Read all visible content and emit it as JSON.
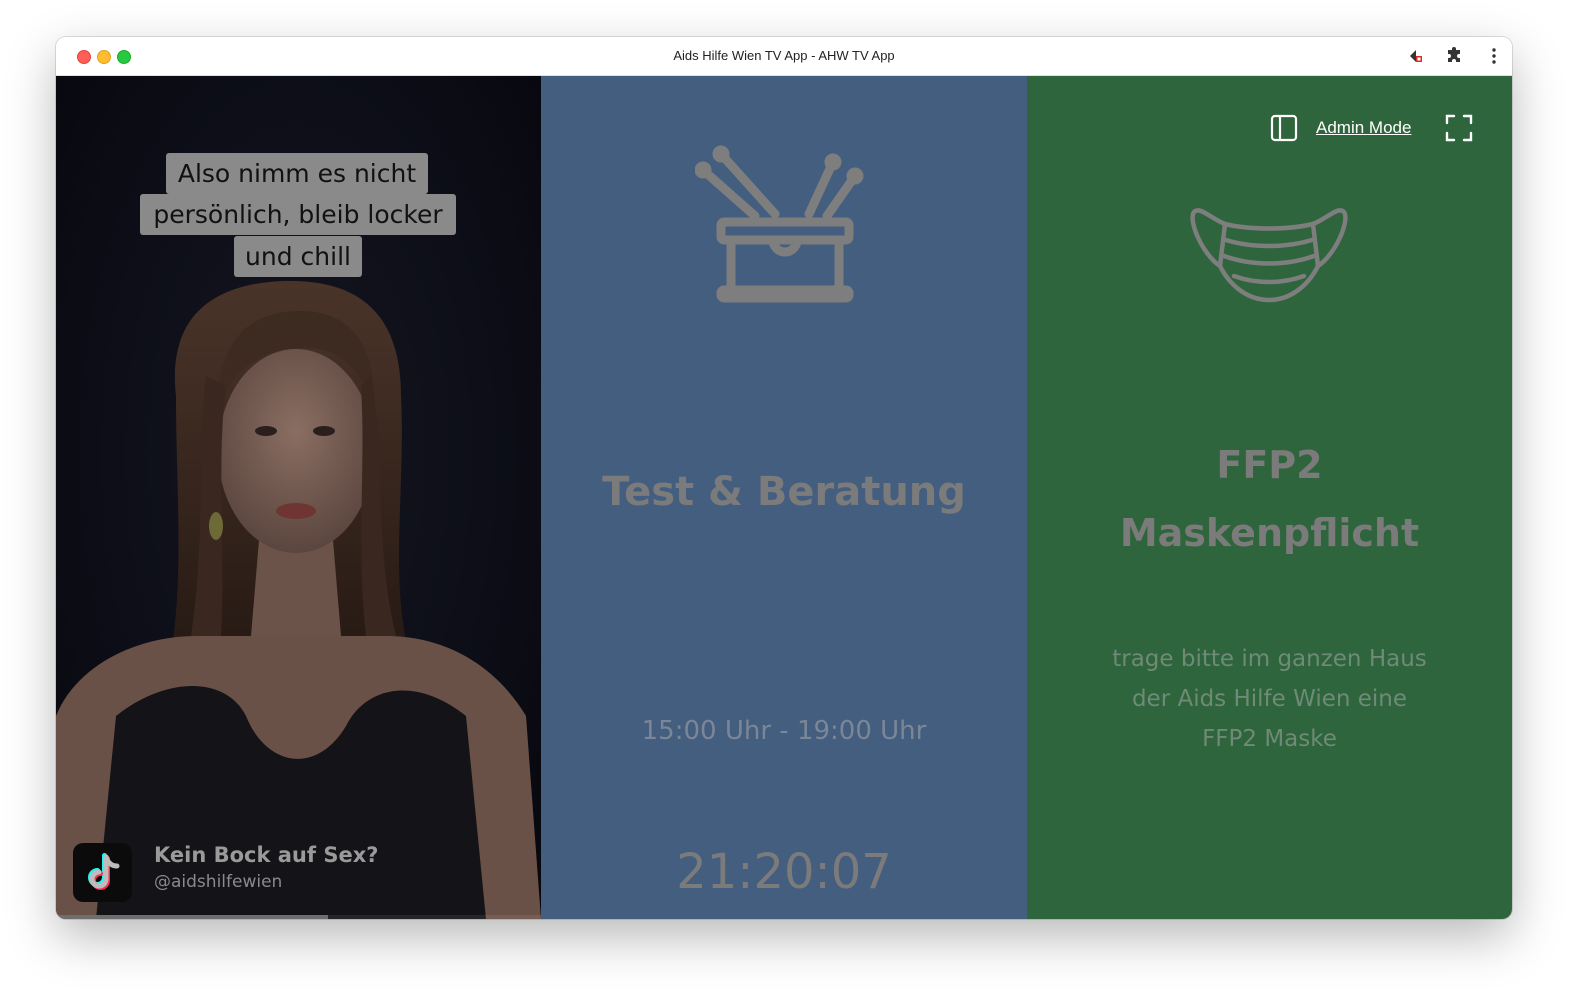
{
  "window": {
    "title": "Aids Hilfe Wien TV App - AHW TV App"
  },
  "video": {
    "caption_lines": [
      "Also nimm es nicht",
      "persönlich, bleib locker",
      "und chill"
    ],
    "tiktok_title": "Kein Bock auf Sex?",
    "tiktok_handle": "@aidshilfewien",
    "progress": 0.56
  },
  "test_panel": {
    "title": "Test & Beratung",
    "hours": "15:00 Uhr - 19:00 Uhr",
    "clock": "21:20:07",
    "icon": "drum-icon"
  },
  "mask_panel": {
    "title_line1": "FFP2",
    "title_line2": "Maskenpflicht",
    "body_line1": "trage bitte im ganzen Haus",
    "body_line2": "der Aids Hilfe Wien eine",
    "body_line3": "FFP2 Maske",
    "icon": "face-mask-icon"
  },
  "toolbar": {
    "admin_label": "Admin Mode"
  },
  "colors": {
    "blue_panel": "#445e80",
    "green_panel": "#2e653c",
    "video_bg": "#0d0e18"
  }
}
